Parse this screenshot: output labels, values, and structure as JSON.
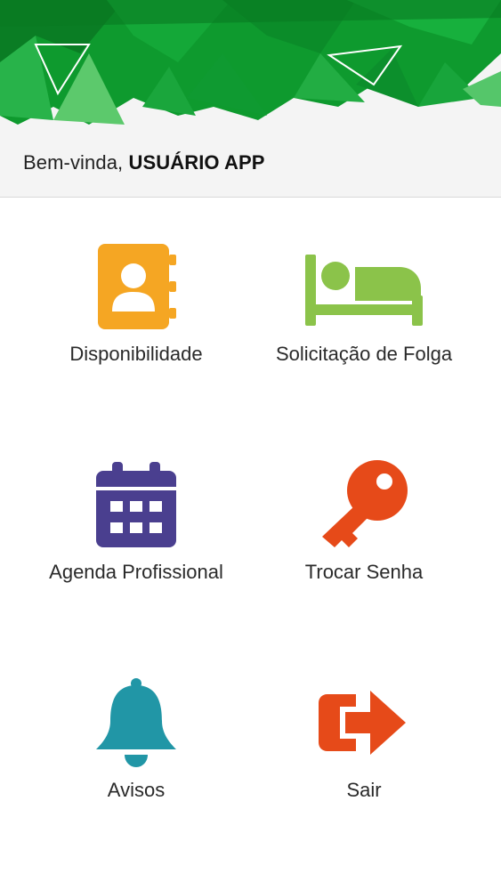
{
  "header": {
    "greeting": "Bem-vinda,",
    "user_name": "USUÁRIO APP"
  },
  "menu": [
    {
      "label": "Disponibilidade",
      "icon": "contacts-book-icon",
      "color": "#F5A623"
    },
    {
      "label": "Solicitação de Folga",
      "icon": "bed-icon",
      "color": "#8BC34A"
    },
    {
      "label": "Agenda Profissional",
      "icon": "calendar-icon",
      "color": "#4A3F8F"
    },
    {
      "label": "Trocar Senha",
      "icon": "key-icon",
      "color": "#E64A19"
    },
    {
      "label": "Avisos",
      "icon": "bell-icon",
      "color": "#2196A6"
    },
    {
      "label": "Sair",
      "icon": "sign-out-icon",
      "color": "#E64A19"
    }
  ],
  "colors": {
    "banner_green_dark": "#0a8f2a",
    "banner_green_light": "#3dbb4e",
    "header_bg": "#f4f4f4"
  }
}
